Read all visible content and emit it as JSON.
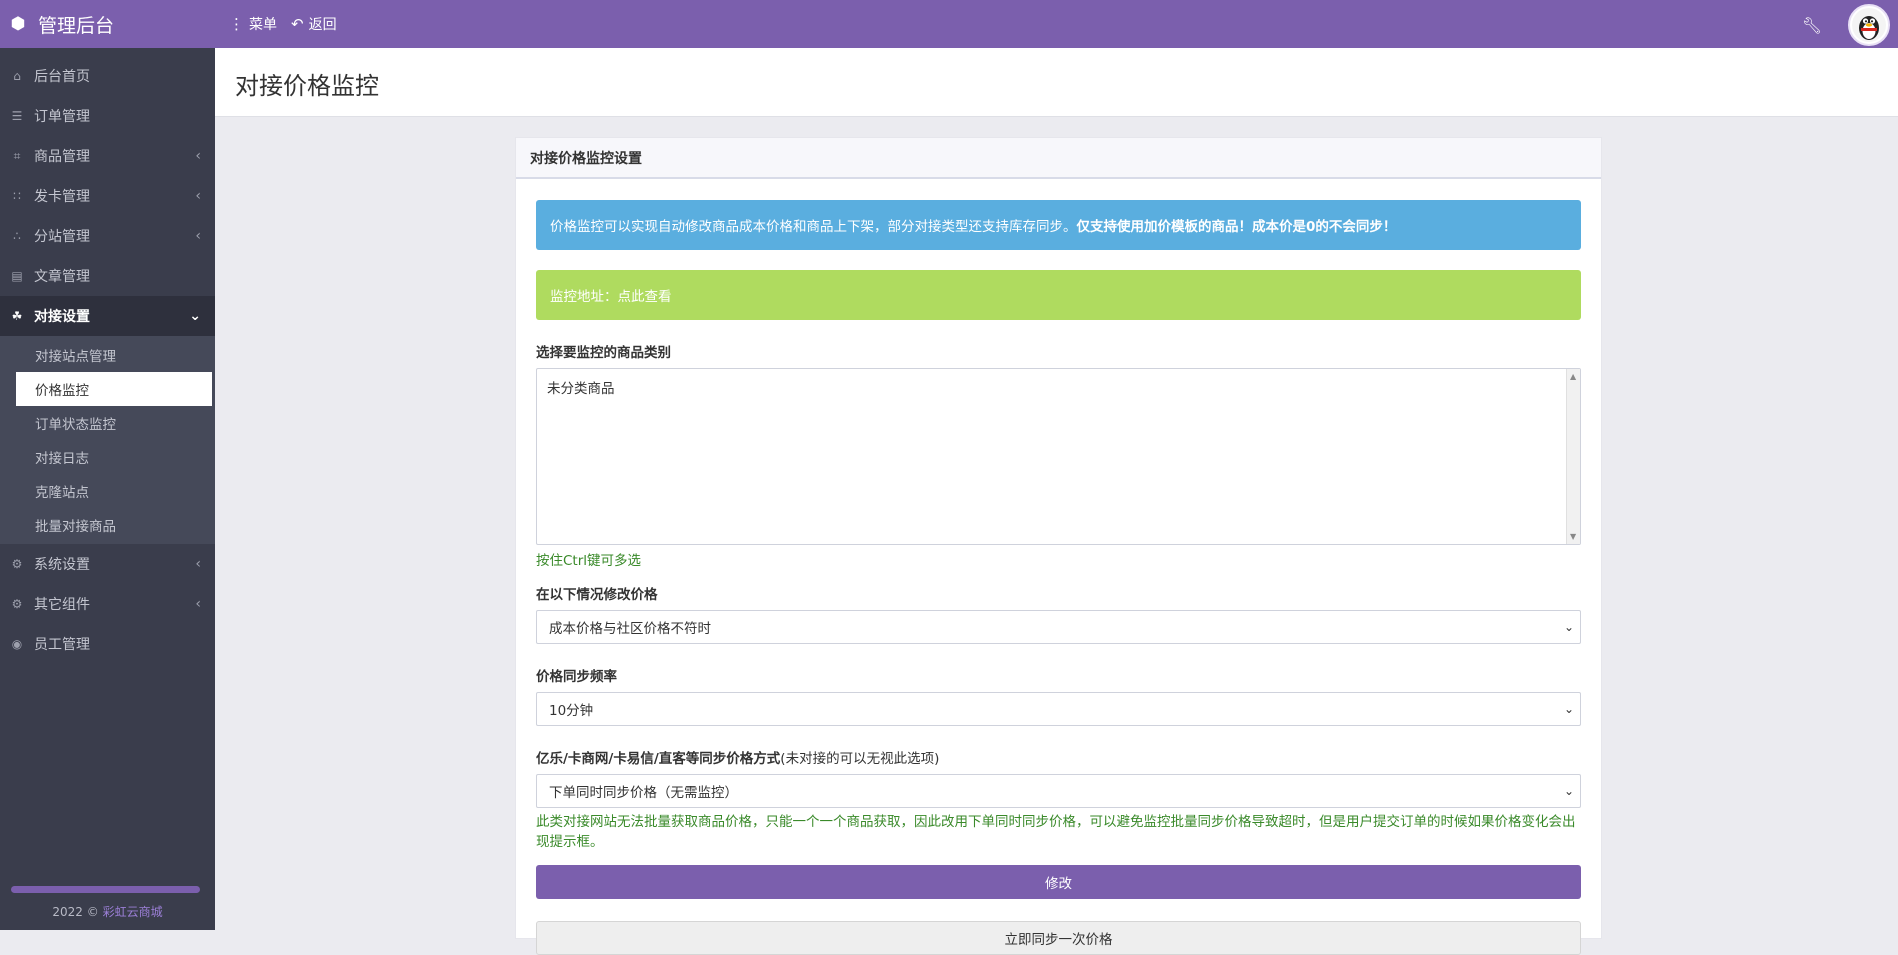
{
  "brand": {
    "title": "管理后台",
    "icon": "cube-icon"
  },
  "topbar": {
    "menu_label": "菜单",
    "back_label": "返回",
    "menu_icon": "vertical-dots-icon",
    "back_icon": "undo-arrow-icon",
    "settings_icon": "wrench-icon",
    "avatar_icon": "qq-penguin-avatar"
  },
  "sidebar": {
    "items": [
      {
        "label": "后台首页",
        "icon": "home-icon"
      },
      {
        "label": "订单管理",
        "icon": "list-icon"
      },
      {
        "label": "商品管理",
        "icon": "cart-icon",
        "caret": "‹"
      },
      {
        "label": "发卡管理",
        "icon": "grid-icon",
        "caret": "‹"
      },
      {
        "label": "分站管理",
        "icon": "sitemap-icon",
        "caret": "‹"
      },
      {
        "label": "文章管理",
        "icon": "book-icon"
      },
      {
        "label": "对接设置",
        "icon": "cubes-icon",
        "caret": "⌄"
      },
      {
        "label": "系统设置",
        "icon": "cog-icon",
        "caret": "‹"
      },
      {
        "label": "其它组件",
        "icon": "cogs-icon",
        "caret": "‹"
      },
      {
        "label": "员工管理",
        "icon": "user-circle-icon"
      }
    ],
    "subitems": [
      {
        "label": "对接站点管理"
      },
      {
        "label": "价格监控"
      },
      {
        "label": "订单状态监控"
      },
      {
        "label": "对接日志"
      },
      {
        "label": "克隆站点"
      },
      {
        "label": "批量对接商品"
      }
    ],
    "footer_prefix": "2022 ©",
    "footer_link": "彩虹云商城"
  },
  "page": {
    "title": "对接价格监控"
  },
  "card": {
    "header": "对接价格监控设置",
    "info_text": "价格监控可以实现自动修改商品成本价格和商品上下架，部分对接类型还支持库存同步。",
    "info_strong": "仅支持使用加价模板的商品！成本价是0的不会同步！",
    "monitor_text": "监控地址：点此查看",
    "category_label": "选择要监控的商品类别",
    "category_option": "未分类商品",
    "category_help": "按住Ctrl键可多选",
    "modify_label": "在以下情况修改价格",
    "modify_value": "成本价格与社区价格不符时",
    "freq_label": "价格同步频率",
    "freq_value": "10分钟",
    "sync_label": "亿乐/卡商网/卡易信/直客等同步价格方式",
    "sync_label_note": "(未对接的可以无视此选项)",
    "sync_value": "下单同时同步价格（无需监控）",
    "sync_help": "此类对接网站无法批量获取商品价格，只能一个一个商品获取，因此改用下单同时同步价格，可以避免监控批量同步价格导致超时，但是用户提交订单的时候如果价格变化会出现提示框。",
    "submit_label": "修改",
    "sync_now_label": "立即同步一次价格"
  }
}
